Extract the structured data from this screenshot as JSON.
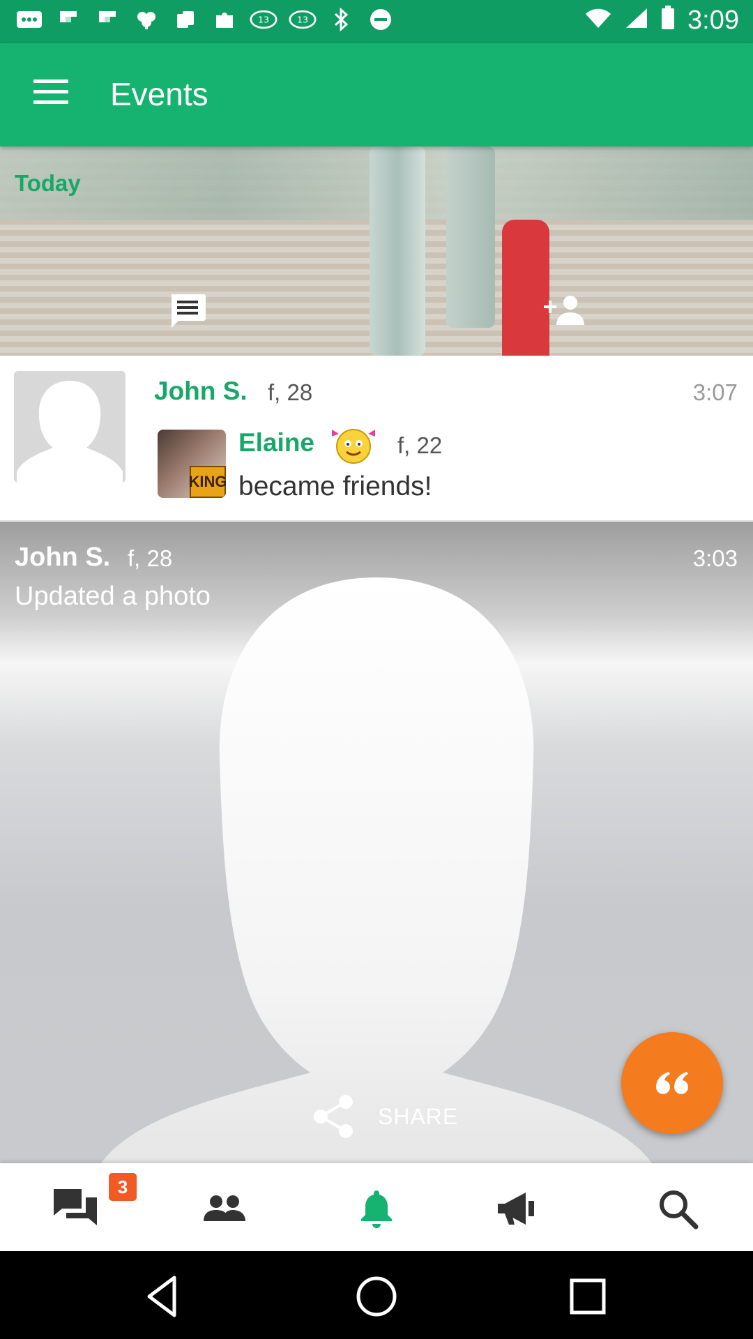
{
  "status_bar": {
    "time": "3:09",
    "icons": [
      "more-icon",
      "flipboard-icon",
      "flipboard-icon",
      "ace-icon",
      "cards-icon",
      "puzzle-icon",
      "abc13-icon",
      "abc13-icon",
      "bluetooth-icon",
      "dnd-icon",
      "wifi-icon",
      "cellular-icon",
      "battery-icon"
    ]
  },
  "app_bar": {
    "title": "Events"
  },
  "hero": {
    "section_label": "Today"
  },
  "friend_event": {
    "user_name": "John S.",
    "user_meta": "f, 28",
    "time": "3:07",
    "friend_name": "Elaine",
    "friend_meta": "f, 22",
    "badge_text": "KING",
    "action": "became friends!"
  },
  "photo_event": {
    "user_name": "John S.",
    "user_meta": "f, 28",
    "time": "3:03",
    "action": "Updated a photo",
    "share_label": "SHARE"
  },
  "bottom_nav": {
    "chat_badge": "3",
    "items": [
      "chat-icon",
      "people-icon",
      "bell-icon",
      "megaphone-icon",
      "search-icon"
    ],
    "active": "bell-icon"
  },
  "colors": {
    "primary": "#15b36f",
    "primary_dark": "#0f9d63",
    "accent": "#f47c1f",
    "badge": "#f15a24"
  }
}
